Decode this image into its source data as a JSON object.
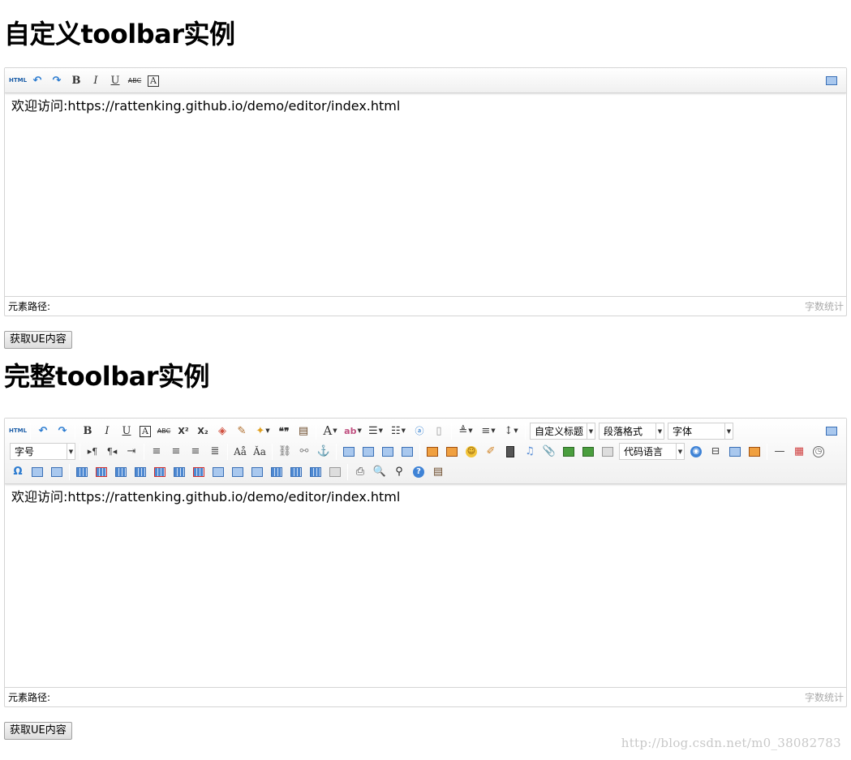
{
  "section1": {
    "title": "自定义toolbar实例",
    "content_text": "欢迎访问:https://rattenking.github.io/demo/editor/index.html",
    "status_path": "元素路径:",
    "word_count": "字数统计",
    "get_button": "获取UE内容"
  },
  "section2": {
    "title": "完整toolbar实例",
    "content_text": "欢迎访问:https://rattenking.github.io/demo/editor/index.html",
    "status_path": "元素路径:",
    "word_count": "字数统计",
    "get_button": "获取UE内容",
    "combos": {
      "custom_heading": "自定义标题",
      "paragraph": "段落格式",
      "font_family": "字体",
      "font_size": "字号",
      "code_language": "代码语言"
    }
  },
  "toolbar_glyphs": {
    "html": "HTML",
    "undo": "↶",
    "redo": "↷",
    "bold": "B",
    "italic": "I",
    "underline": "U",
    "strike": "ABC",
    "font_border": "A",
    "superscript": "X²",
    "subscript": "X₂",
    "quote": "❝❞",
    "font_color": "A",
    "anchor": "⚓",
    "omega": "Ω",
    "hr": "—"
  },
  "watermark": "http://blog.csdn.net/m0_38082783"
}
